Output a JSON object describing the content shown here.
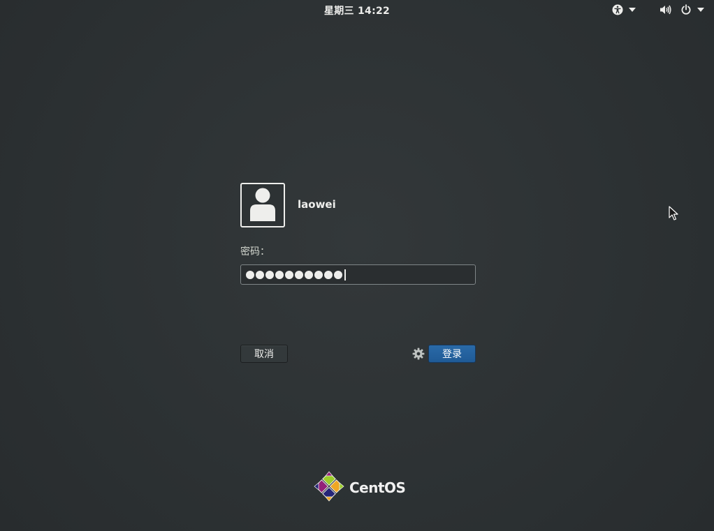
{
  "topbar": {
    "clock": "星期三 14:22",
    "accessibility_icon": "accessibility-icon",
    "volume_icon": "volume-icon",
    "power_icon": "power-icon"
  },
  "login": {
    "username": "laowei",
    "password_label": "密码：",
    "password_masked_length": 10,
    "cancel_label": "取消",
    "login_label": "登录",
    "session_icon": "gear-icon"
  },
  "branding": {
    "wordmark": "CentOS"
  },
  "colors": {
    "background": "#2d3234",
    "accent": "#215d9c",
    "text": "#eeeeec"
  }
}
